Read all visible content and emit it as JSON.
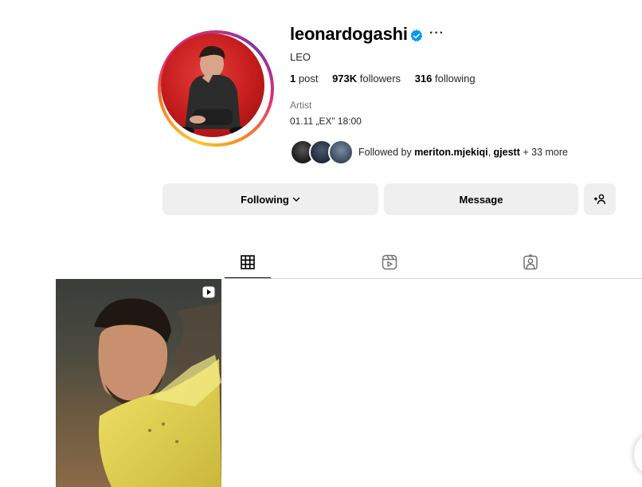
{
  "profile": {
    "username": "leonardogashi",
    "full_name": "LEO",
    "verified": true,
    "stats": {
      "posts_count": "1",
      "posts_label": "post",
      "followers_count": "973K",
      "followers_label": "followers",
      "following_count": "316",
      "following_label": "following"
    },
    "category": "Artist",
    "bio": "01.11 „EX” 18:00",
    "followed_by": {
      "prefix": "Followed by",
      "user1": "meriton.mjekiqi",
      "separator": ",",
      "user2": "gjestt",
      "suffix": "+ 33 more"
    }
  },
  "actions": {
    "following_label": "Following",
    "message_label": "Message"
  },
  "tabs": [
    {
      "icon": "grid-icon",
      "active": true
    },
    {
      "icon": "reels-icon",
      "active": false
    },
    {
      "icon": "tagged-icon",
      "active": false
    }
  ],
  "posts": [
    {
      "type": "reel",
      "badge_icon": "reel-badge-icon"
    }
  ],
  "colors": {
    "verified_blue": "#0095f6",
    "button_bg": "#efefef",
    "secondary_text": "#737373",
    "divider": "#dbdbdb"
  }
}
